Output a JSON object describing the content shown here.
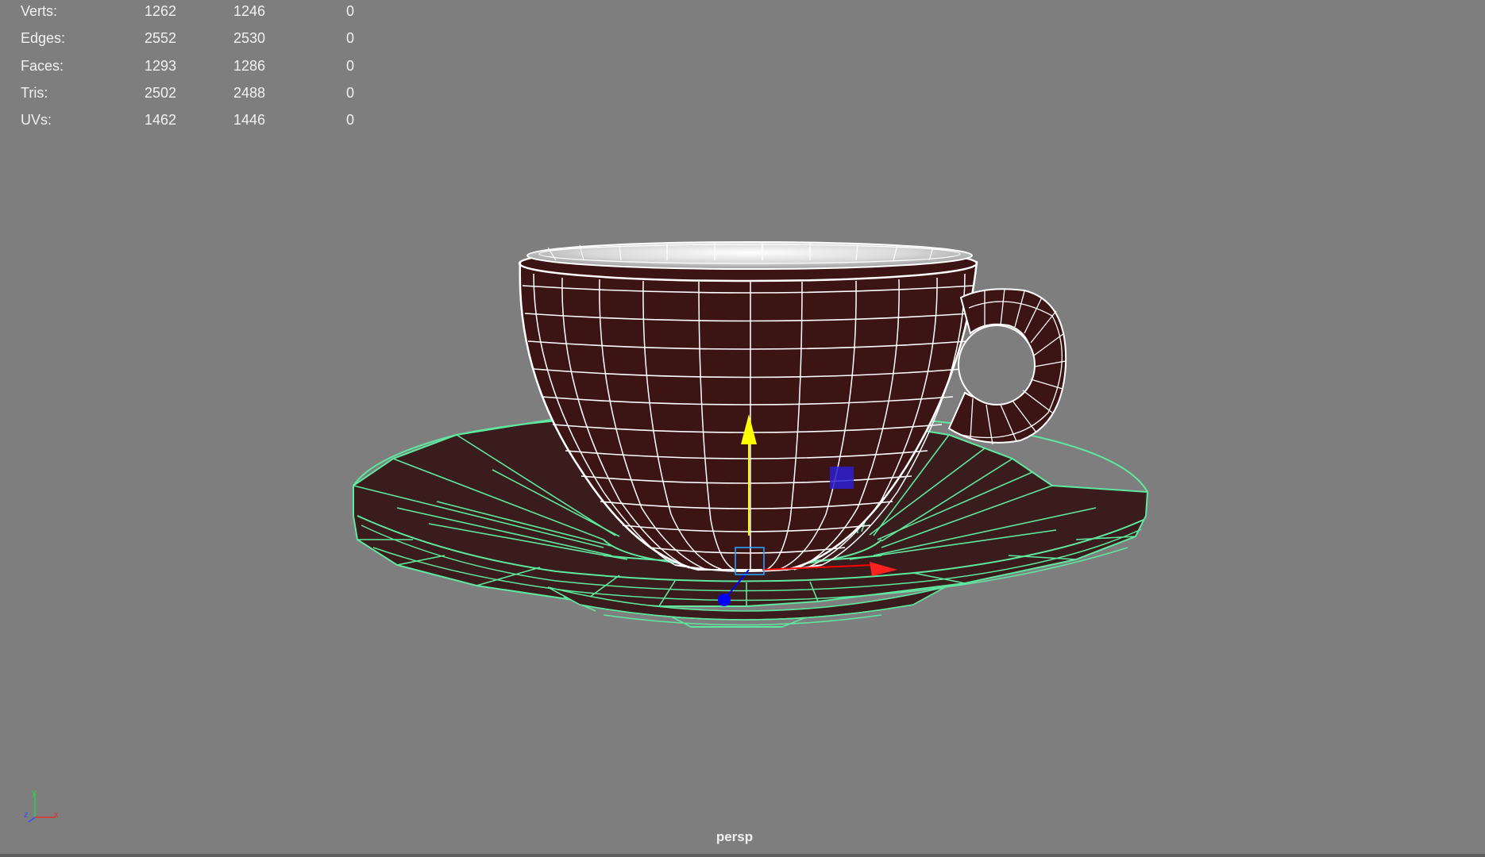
{
  "hud": {
    "rows": [
      {
        "label": "Verts:",
        "c1": "1262",
        "c2": "1246",
        "c3": "0"
      },
      {
        "label": "Edges:",
        "c1": "2552",
        "c2": "2530",
        "c3": "0"
      },
      {
        "label": "Faces:",
        "c1": "1293",
        "c2": "1286",
        "c3": "0"
      },
      {
        "label": "Tris:",
        "c1": "2502",
        "c2": "2488",
        "c3": "0"
      },
      {
        "label": "UVs:",
        "c1": "1462",
        "c2": "1446",
        "c3": "0"
      }
    ]
  },
  "camera": {
    "label": "persp"
  },
  "axes": {
    "y": "y",
    "z": "z",
    "x": "x"
  },
  "colors": {
    "background": "#7e7e7e",
    "selection_wire": "#5fe8a0",
    "mesh_wire": "#ffffff",
    "mesh_fill": "#3a1414",
    "manip_y": "#ffff00",
    "manip_x": "#ff0000",
    "manip_z": "#0000ff"
  },
  "icons": [
    "teacup-mesh",
    "saucer-mesh",
    "move-manipulator",
    "axis-gizmo"
  ]
}
